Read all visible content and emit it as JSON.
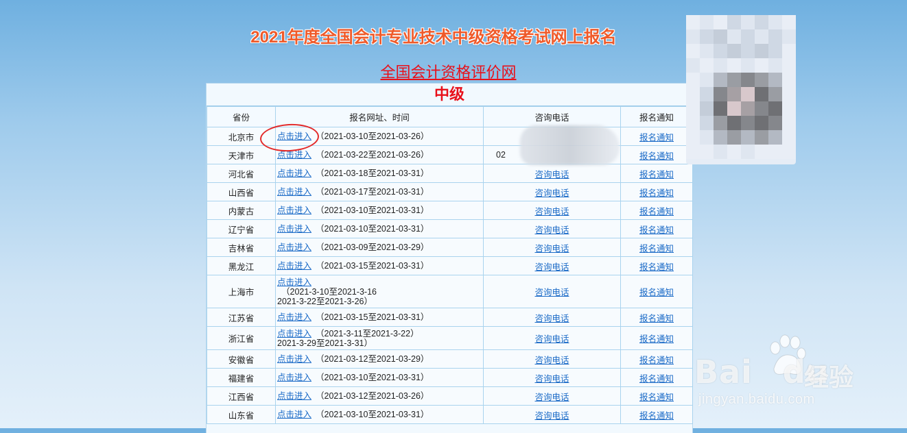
{
  "header": {
    "title": "2021年度全国会计专业技术中级资格考试网上报名",
    "site_link": "全国会计资格评价网"
  },
  "panel": {
    "level": "中级",
    "columns": [
      "省份",
      "报名网址、时间",
      "咨询电话",
      "报名通知"
    ],
    "enter_label": "点击进入",
    "tel_label": "咨询电话",
    "notice_label": "报名通知",
    "rows": [
      {
        "province": "北京市",
        "period": "（2021-03-10至2021-03-26）",
        "tel": "",
        "period2": ""
      },
      {
        "province": "天津市",
        "period": "（2021-03-22至2021-03-26）",
        "tel": "02",
        "period2": ""
      },
      {
        "province": "河北省",
        "period": "（2021-03-18至2021-03-31）",
        "tel": "咨询电话",
        "period2": ""
      },
      {
        "province": "山西省",
        "period": "（2021-03-17至2021-03-31）",
        "tel": "咨询电话",
        "period2": ""
      },
      {
        "province": "内蒙古",
        "period": "（2021-03-10至2021-03-31）",
        "tel": "咨询电话",
        "period2": ""
      },
      {
        "province": "辽宁省",
        "period": "（2021-03-10至2021-03-31）",
        "tel": "咨询电话",
        "period2": ""
      },
      {
        "province": "吉林省",
        "period": "（2021-03-09至2021-03-29）",
        "tel": "咨询电话",
        "period2": ""
      },
      {
        "province": "黑龙江",
        "period": "（2021-03-15至2021-03-31）",
        "tel": "咨询电话",
        "period2": ""
      },
      {
        "province": "上海市",
        "period": "（2021-3-10至2021-3-16",
        "tel": "咨询电话",
        "period2": "2021-3-22至2021-3-26）"
      },
      {
        "province": "江苏省",
        "period": "（2021-03-15至2021-03-31）",
        "tel": "咨询电话",
        "period2": ""
      },
      {
        "province": "浙江省",
        "period": "（2021-3-11至2021-3-22）",
        "tel": "咨询电话",
        "period2": "2021-3-29至2021-3-31）"
      },
      {
        "province": "安徽省",
        "period": "（2021-03-12至2021-03-29）",
        "tel": "咨询电话",
        "period2": ""
      },
      {
        "province": "福建省",
        "period": "（2021-03-10至2021-03-31）",
        "tel": "咨询电话",
        "period2": ""
      },
      {
        "province": "江西省",
        "period": "（2021-03-12至2021-03-26）",
        "tel": "咨询电话",
        "period2": ""
      },
      {
        "province": "山东省",
        "period": "（2021-03-10至2021-03-31）",
        "tel": "咨询电话",
        "period2": ""
      }
    ]
  },
  "watermark": {
    "brand": "Bai",
    "brand_du": "du",
    "product": "经验",
    "url": "jingyan.baidu.com"
  },
  "colors": {
    "title": "#ef5a2a",
    "accent_red": "#e8101a",
    "link": "#1a6ac7",
    "circle": "#e32a2a"
  }
}
